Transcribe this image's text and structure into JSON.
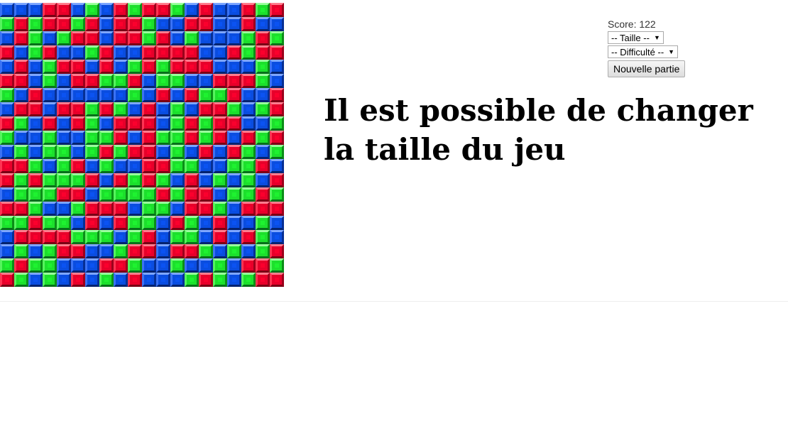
{
  "score": {
    "label": "Score: 122"
  },
  "controls": {
    "size_select": "-- Taille --",
    "difficulty_select": "-- Difficulté --",
    "new_game_button": "Nouvelle partie"
  },
  "headline": "Il est possible de changer la taille du jeu",
  "board": {
    "columns": 20,
    "colors": {
      "r": "#e8002a",
      "g": "#1ce02c",
      "b": "#0a4de0"
    },
    "rows": [
      "bbbrrbgbrgrrgbrbbrgr",
      "grgrrgrbrrgbbrrbbrbb",
      "brgbgrrbrrgrbgbbbgrg",
      "rbgrbbgrbbrrrrbbrgrr",
      "brbgrrbrbgrgrrrbbbgb",
      "rrbgbrrggrbggbbrrrgb",
      "gbrbbbbbbgbrbrggrbbr",
      "brrbrrgrgbrbgbrrgbgr",
      "rgbrbrgbrrrbgrgrrbbg",
      "gbbgbbggrbrggrgrbrgr",
      "bgbggbgrgrrbgbrbrgbg",
      "rrgbgrbgbbrrggbbggrb",
      "rgrgggrbrgrgbrbgbgbr",
      "bgggrrbggggrgrrbggrg",
      "rrgbbgrrrbggbrrgbrrr",
      "ggrggbrbrggbrgbrbbgb",
      "brrrrgggbgrbggbrbrgb",
      "bgbgrrbbgrrbrrgbgbgr",
      "grggbbbrrgbbgbbgbrrg",
      "rgbgbrbgbrbbbgrgbgrr"
    ]
  }
}
